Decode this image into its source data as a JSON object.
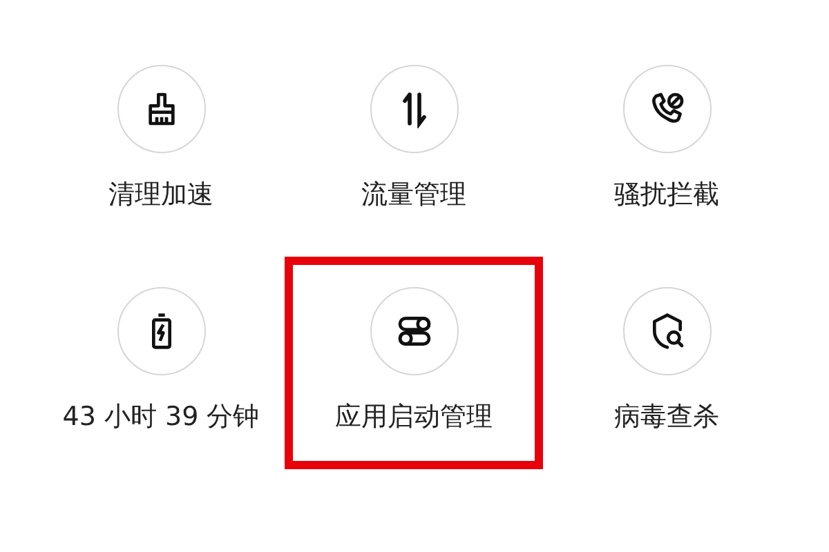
{
  "tools": [
    {
      "label": "清理加速",
      "kind": "broom",
      "highlighted": false
    },
    {
      "label": "流量管理",
      "kind": "updown",
      "highlighted": false
    },
    {
      "label": "骚扰拦截",
      "kind": "phoneblock",
      "highlighted": false
    },
    {
      "label": "43 小时 39 分钟",
      "kind": "battery",
      "highlighted": false
    },
    {
      "label": "应用启动管理",
      "kind": "toggles",
      "highlighted": true
    },
    {
      "label": "病毒查杀",
      "kind": "shieldsearch",
      "highlighted": false
    }
  ]
}
